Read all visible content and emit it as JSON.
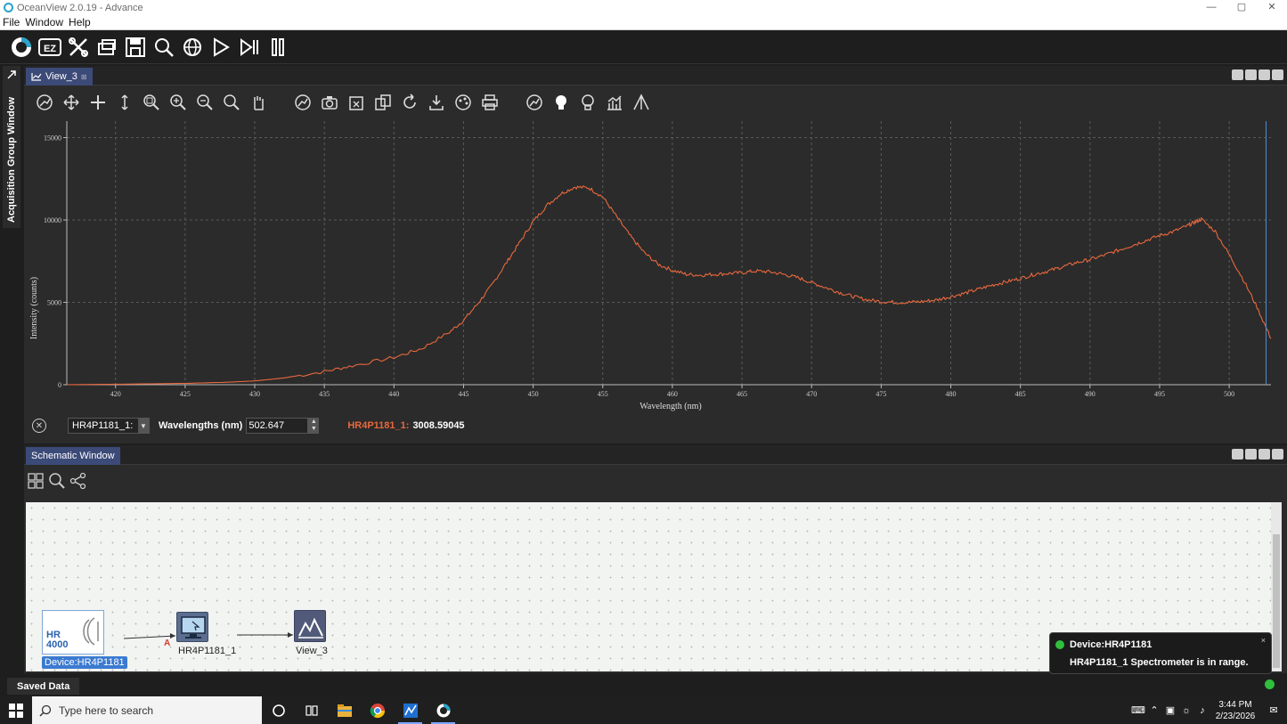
{
  "window": {
    "title": "OceanView 2.0.19 - Advance"
  },
  "menu": {
    "items": [
      "File",
      "Window",
      "Help"
    ]
  },
  "sidebar": {
    "label": "Acquisition Group Window"
  },
  "view": {
    "tab_label": "View_3"
  },
  "chart_data": {
    "type": "line",
    "xlabel": "Wavelength (nm)",
    "ylabel": "Intensity (counts)",
    "xlim": [
      416.5,
      503
    ],
    "ylim": [
      0,
      16000
    ],
    "x_ticks": [
      420,
      425,
      430,
      435,
      440,
      445,
      450,
      455,
      460,
      465,
      470,
      475,
      480,
      485,
      490,
      495,
      500
    ],
    "y_ticks": [
      0,
      5000,
      10000,
      15000
    ],
    "grid": true,
    "series_color": "#e8683d",
    "series": [
      {
        "x": [
          416.5,
          420,
          425,
          428,
          430,
          432,
          435,
          437,
          440,
          442,
          444,
          445,
          446,
          447,
          448,
          449,
          450,
          451,
          452,
          453,
          454,
          455,
          456,
          457,
          458,
          459,
          460,
          461,
          462,
          463,
          464,
          465,
          466,
          467,
          468,
          469,
          470,
          471,
          472,
          473,
          474,
          475,
          476,
          477,
          478,
          479,
          480,
          481,
          482,
          483,
          484,
          485,
          486,
          487,
          488,
          489,
          490,
          491,
          492,
          493,
          494,
          495,
          496,
          497,
          497.5,
          498,
          499,
          500,
          501,
          502,
          503
        ],
        "y": [
          0,
          30,
          80,
          150,
          230,
          400,
          800,
          1150,
          1650,
          2200,
          3200,
          3900,
          4900,
          6000,
          7300,
          8600,
          9900,
          10900,
          11600,
          12000,
          11950,
          11400,
          10200,
          9000,
          8000,
          7300,
          6950,
          6700,
          6650,
          6700,
          6750,
          6800,
          6900,
          6850,
          6700,
          6500,
          6200,
          5900,
          5600,
          5350,
          5150,
          5050,
          5000,
          5000,
          5050,
          5150,
          5350,
          5550,
          5800,
          6050,
          6250,
          6450,
          6700,
          6900,
          7150,
          7400,
          7600,
          7850,
          8150,
          8450,
          8750,
          9050,
          9300,
          9650,
          9850,
          10050,
          9300,
          7900,
          6400,
          4700,
          2800
        ]
      }
    ]
  },
  "cursor": {
    "series_select": "HR4P1181_1:",
    "wavelength_label": "Wavelengths (nm)",
    "wavelength_value": "502.647",
    "readout_label": "HR4P1181_1:",
    "readout_value": "3008.59045"
  },
  "schematic": {
    "tab_label": "Schematic Window",
    "device_icon_text": "HR 4000",
    "device_label": "Device:HR4P1181",
    "spectrometer_label": "HR4P1181_1",
    "view_label": "View_3",
    "channel_letter": "A"
  },
  "notification": {
    "title": "Device:HR4P1181",
    "message": "HR4P1181_1 Spectrometer is in range.",
    "close": "×"
  },
  "status": {
    "saved_tab": "Saved Data"
  },
  "taskbar": {
    "search_placeholder": "Type here to search",
    "time": "3:44 PM",
    "date": "2/23/2026"
  }
}
